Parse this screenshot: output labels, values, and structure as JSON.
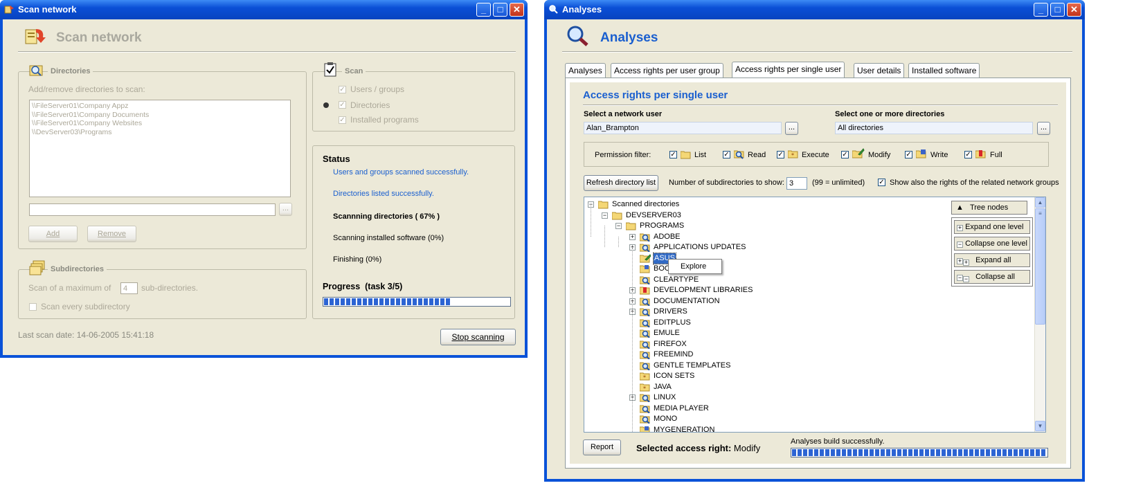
{
  "scan_window": {
    "title": "Scan network",
    "header": "Scan network",
    "directories": {
      "group_label": "Directories",
      "instruction": "Add/remove directories to scan:",
      "list": [
        "\\\\FileServer01\\Company Appz",
        "\\\\FileServer01\\Company Documents",
        "\\\\FileServer01\\Company Websites",
        "\\\\DevServer03\\Programs"
      ],
      "path_value": "",
      "browse_label": "...",
      "add_label": "Add",
      "remove_label": "Remove"
    },
    "subdirectories": {
      "group_label": "Subdirectories",
      "max_prefix": "Scan of a maximum of",
      "max_value": "4",
      "max_suffix": "sub-directories.",
      "every_label": "Scan every subdirectory"
    },
    "scan": {
      "group_label": "Scan",
      "items": [
        "Users / groups",
        "Directories",
        "Installed programs"
      ]
    },
    "status": {
      "heading": "Status",
      "lines": [
        "Users and groups scanned successfully.",
        "Directories listed successfully.",
        "Scannning directories ( 67% )",
        "Scanning installed software (0%)",
        "Finishing (0%)"
      ],
      "progress_label": "Progress  (task 3/5)",
      "progress_fraction": 0.68
    },
    "last_scan": "Last scan date: 14-06-2005 15:41:18",
    "stop_label": "Stop scanning"
  },
  "analyses_window": {
    "title": "Analyses",
    "header": "Analyses",
    "tabs": [
      "Analyses",
      "Access rights per user group",
      "Access rights per single user",
      "User details",
      "Installed software"
    ],
    "active_tab": 2,
    "section_title": "Access rights per single user",
    "user_label": "Select a network user",
    "user_value": "Alan_Brampton",
    "dir_label": "Select one or more directories",
    "dir_value": "All directories",
    "browse_label": "...",
    "permission_filter_label": "Permission filter:",
    "permissions": [
      "List",
      "Read",
      "Execute",
      "Modify",
      "Write",
      "Full"
    ],
    "refresh_label": "Refresh directory list",
    "subdirs_label": "Number of subdirectories to show:",
    "subdirs_value": "3",
    "subdirs_hint": "(99 = unlimited)",
    "show_groups_label": "Show also the rights of the related network groups",
    "tree": {
      "root": "Scanned directories",
      "server": "DEVSERVER03",
      "programs": "PROGRAMS",
      "items": [
        "ADOBE",
        "APPLICATIONS UPDATES",
        "ASUS",
        "BOO",
        "CLEARTYPE",
        "DEVELOPMENT LIBRARIES",
        "DOCUMENTATION",
        "DRIVERS",
        "EDITPLUS",
        "EMULE",
        "FIREFOX",
        "FREEMIND",
        "GENTLE TEMPLATES",
        "ICON SETS",
        "JAVA",
        "LINUX",
        "MEDIA PLAYER",
        "MONO",
        "MYGENERATION"
      ]
    },
    "context_menu": [
      "Explore"
    ],
    "tree_nodes": {
      "header": "Tree nodes",
      "buttons": [
        "Expand one level",
        "Collapse one level",
        "Expand all",
        "Collapse all"
      ]
    },
    "report_label": "Report",
    "selected_right_label": "Selected access right:",
    "selected_right_value": "Modify",
    "build_status": "Analyses build successfully.",
    "build_progress_fraction": 1.0
  },
  "colors": {
    "titlebar": "#0a52d8",
    "client_bg": "#ece9d8",
    "accent_blue": "#1a5fcf",
    "progress": "#2c64d3"
  }
}
